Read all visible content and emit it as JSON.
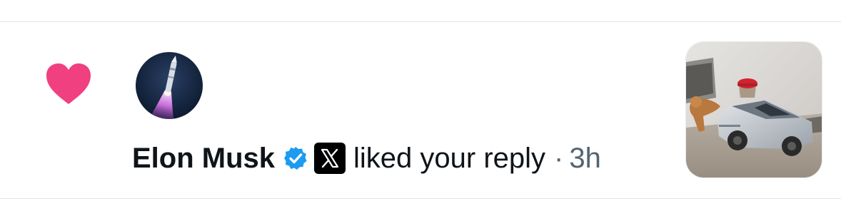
{
  "notification": {
    "type_icon": "heart-icon",
    "avatar_icon": "rocket-launch-avatar",
    "user_name": "Elon Musk",
    "verified_icon": "verified-badge-icon",
    "affiliation_icon": "x-logo-icon",
    "action_text": "liked your reply",
    "separator": "·",
    "time": "3h",
    "thumbnail_icon": "cybertruck-toy-photo",
    "colors": {
      "heart": "#f0407f",
      "verified": "#1d9bf0",
      "text_primary": "#0f1419",
      "text_secondary": "#536471",
      "divider": "#e1e5e8"
    }
  }
}
